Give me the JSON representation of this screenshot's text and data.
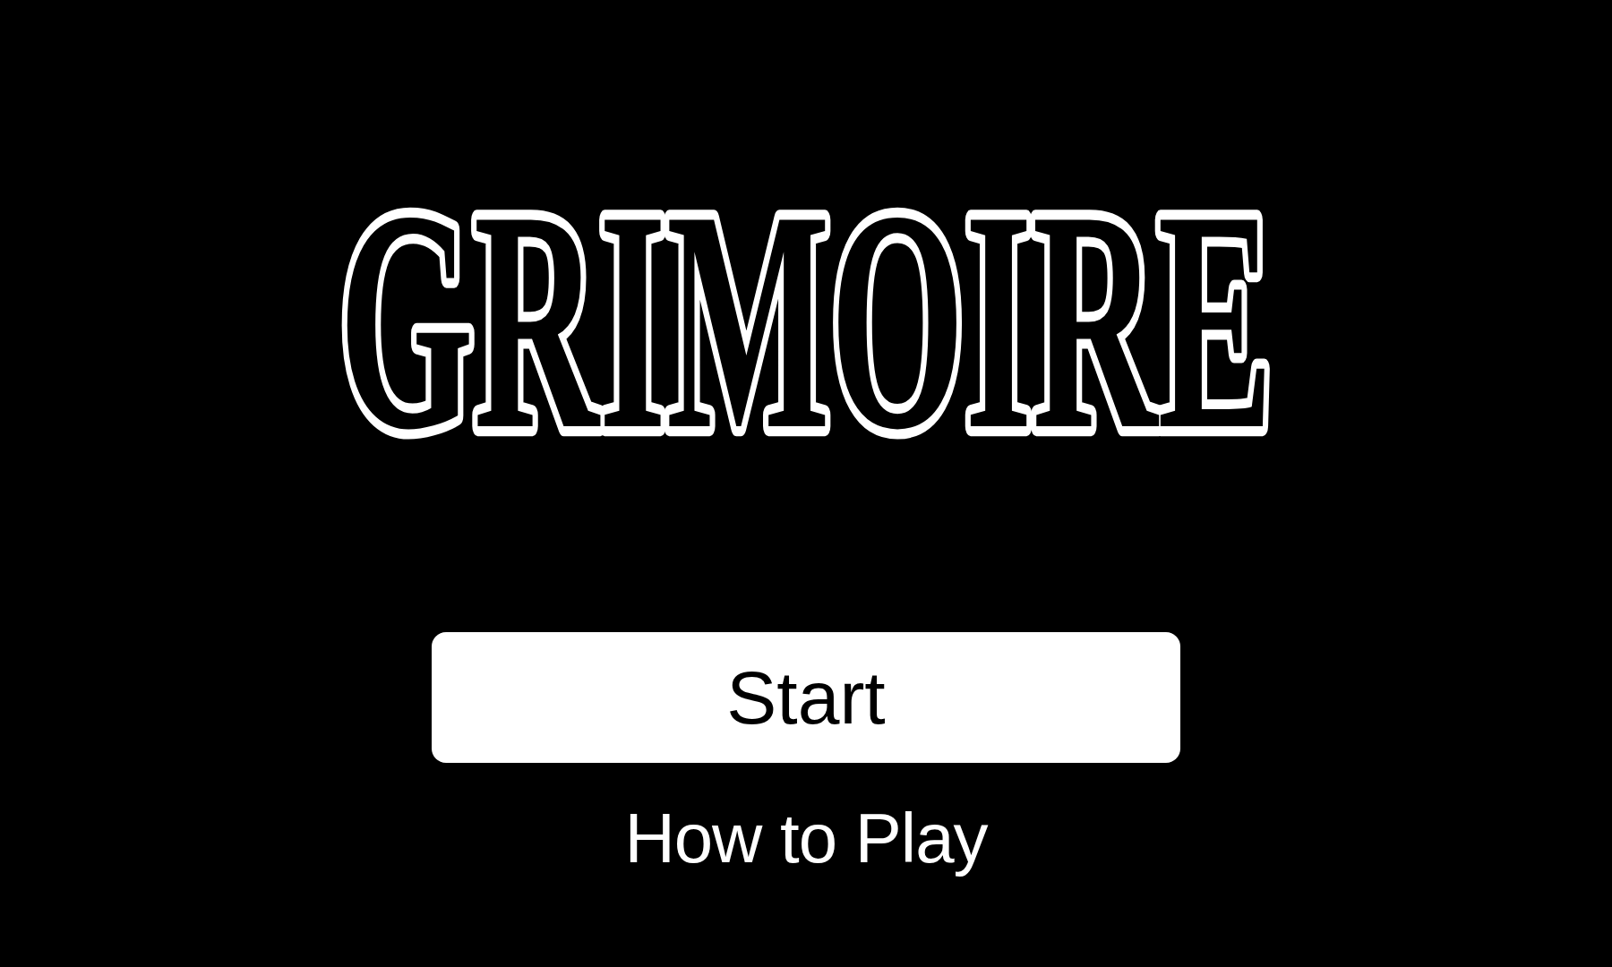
{
  "title": "GRIMOIRE",
  "menu": [
    {
      "label": "Start",
      "kind": "primary"
    },
    {
      "label": "How to Play",
      "kind": "link"
    }
  ]
}
